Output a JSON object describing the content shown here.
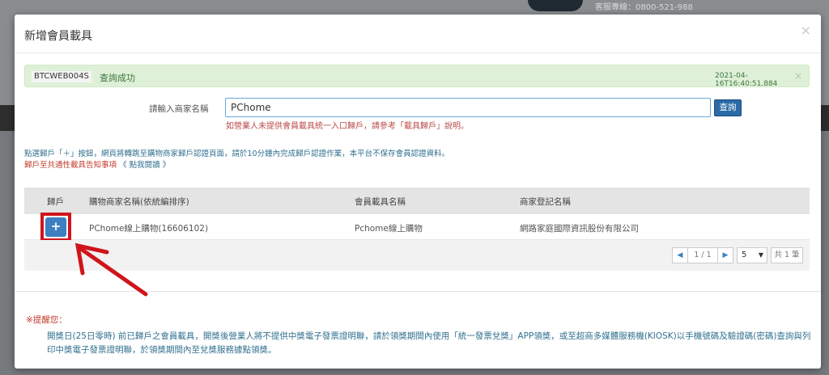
{
  "background": {
    "hotline": "客服專線：0800-521-988"
  },
  "modal": {
    "title": "新增會員載具",
    "close": "×"
  },
  "alert": {
    "code": "BTCWEB004S",
    "message": "查詢成功",
    "timestamp": "2021-04-16T16:40:51.884",
    "close": "×"
  },
  "search": {
    "label": "請輸入商家名稱",
    "value": "PChome",
    "button": "查詢",
    "hint": "如營業人未提供會員載具統一入口歸戶，請參考「載具歸戶」說明。"
  },
  "info": {
    "line1": "點選歸戶「＋」按鈕，網頁將轉跳至購物商家歸戶認證頁面，請於10分鐘內完成歸戶認證作業，本平台不保存會員認證資料。",
    "line2": "歸戶至共通性載具告知事項",
    "line2_link": "《 點我閱讀 》"
  },
  "table": {
    "headers": [
      "歸戶",
      "購物商家名稱(依統編排序)",
      "會員載具名稱",
      "商家登記名稱"
    ],
    "rows": [
      {
        "action": "+",
        "merchant": "PChome線上購物(16606102)",
        "carrier": "Pchome線上購物",
        "registered": "網路家庭國際資訊股份有限公司"
      }
    ],
    "pagination": {
      "prev": "◀",
      "page": "1 / 1",
      "next": "▶",
      "page_size": "5",
      "total": "共 1 筆"
    }
  },
  "notice": {
    "title": "※提醒您：",
    "body": "開獎日(25日零時) 前已歸戶之會員載具，開獎後營業人將不提供中獎電子發票證明聯，請於領獎期間內使用「統一發票兌獎」APP領獎，或至超商多媒體服務機(KIOSK)以手機號碼及驗證碼(密碼)查詢與列印中獎電子發票證明聯，於領獎期間內至兌獎服務據點領獎。"
  },
  "colors": {
    "primary": "#3d7fc1",
    "success_bg": "#dff0d8",
    "danger": "#c0392b",
    "annotation": "#d0141b"
  }
}
